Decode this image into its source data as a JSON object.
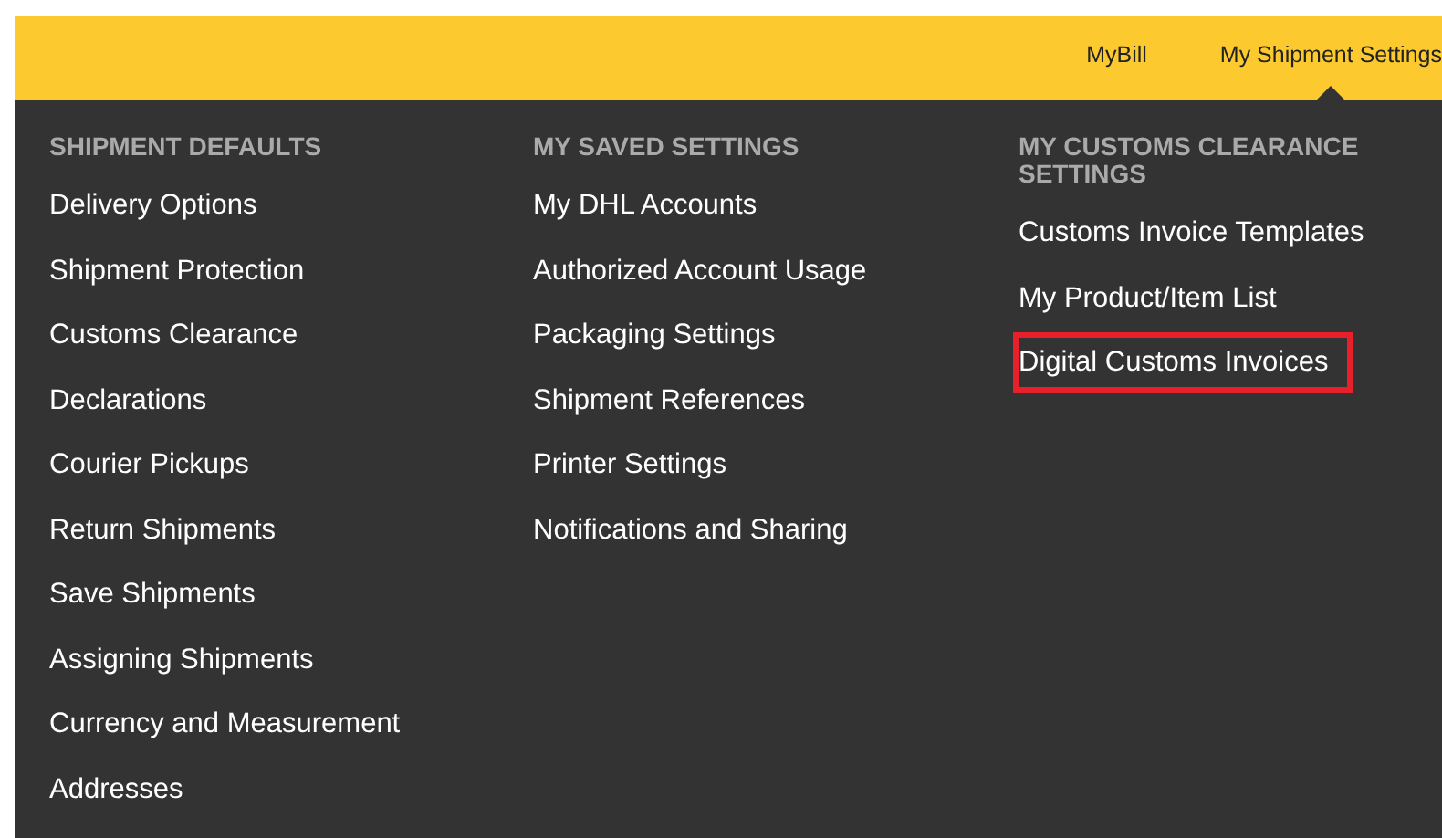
{
  "nav": [
    {
      "label": "MyBill",
      "selected": false
    },
    {
      "label": "My Shipment Settings",
      "selected": true
    }
  ],
  "columns": [
    {
      "heading": "SHIPMENT DEFAULTS",
      "items": [
        {
          "label": "Delivery Options",
          "highlighted": false
        },
        {
          "label": "Shipment Protection",
          "highlighted": false
        },
        {
          "label": "Customs Clearance",
          "highlighted": false
        },
        {
          "label": "Declarations",
          "highlighted": false
        },
        {
          "label": "Courier Pickups",
          "highlighted": false
        },
        {
          "label": "Return Shipments",
          "highlighted": false
        },
        {
          "label": "Save Shipments",
          "highlighted": false
        },
        {
          "label": "Assigning Shipments",
          "highlighted": false
        },
        {
          "label": "Currency and Measurement",
          "highlighted": false
        },
        {
          "label": "Addresses",
          "highlighted": false
        }
      ]
    },
    {
      "heading": "MY SAVED SETTINGS",
      "items": [
        {
          "label": "My DHL Accounts",
          "highlighted": false
        },
        {
          "label": "Authorized Account Usage",
          "highlighted": false
        },
        {
          "label": "Packaging Settings",
          "highlighted": false
        },
        {
          "label": "Shipment References",
          "highlighted": false
        },
        {
          "label": "Printer Settings",
          "highlighted": false
        },
        {
          "label": "Notifications and Sharing",
          "highlighted": false
        }
      ]
    },
    {
      "heading": "MY CUSTOMS CLEARANCE SETTINGS",
      "items": [
        {
          "label": "Customs Invoice Templates",
          "highlighted": false
        },
        {
          "label": "My Product/Item List",
          "highlighted": false
        },
        {
          "label": "Digital Customs Invoices",
          "highlighted": true
        }
      ]
    }
  ]
}
